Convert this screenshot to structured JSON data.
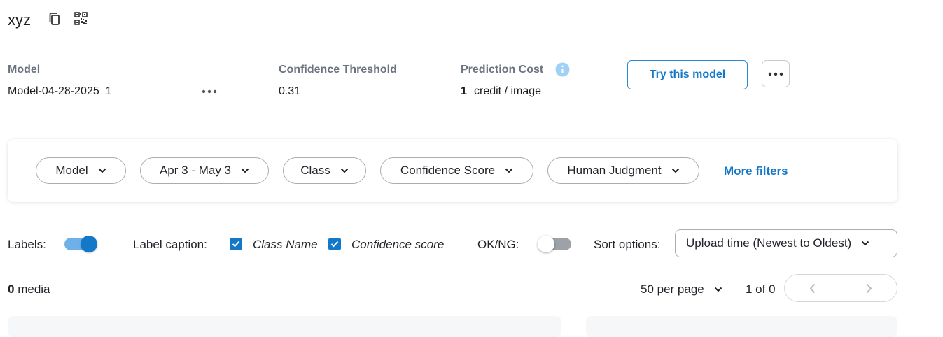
{
  "header": {
    "title": "xyz",
    "copy_icon": "copy-icon",
    "qr_icon": "qr-code-icon"
  },
  "model_info": {
    "model_label": "Model",
    "model_value": "Model-04-28-2025_1",
    "threshold_label": "Confidence Threshold",
    "threshold_value": "0.31",
    "cost_label": "Prediction Cost",
    "cost_amount": "1",
    "cost_unit": "credit / image",
    "try_button": "Try this model"
  },
  "filters": {
    "items": [
      "Model",
      "Apr 3 - May 3",
      "Class",
      "Confidence Score",
      "Human Judgment"
    ],
    "more": "More filters"
  },
  "display_options": {
    "labels_label": "Labels:",
    "labels_on": true,
    "caption_label": "Label caption:",
    "class_name_label": "Class Name",
    "class_name_checked": true,
    "confidence_label": "Confidence score",
    "confidence_checked": true,
    "okng_label": "OK/NG:",
    "okng_on": false,
    "sort_label": "Sort options:",
    "sort_value": "Upload time (Newest to Oldest)"
  },
  "results": {
    "media_count": "0",
    "media_label": "media",
    "per_page": "50 per page",
    "page_info": "1 of 0"
  },
  "colors": {
    "accent": "#1478c8",
    "toggle_track_on": "#6fb0e8",
    "info_icon": "#9fd0f5"
  }
}
